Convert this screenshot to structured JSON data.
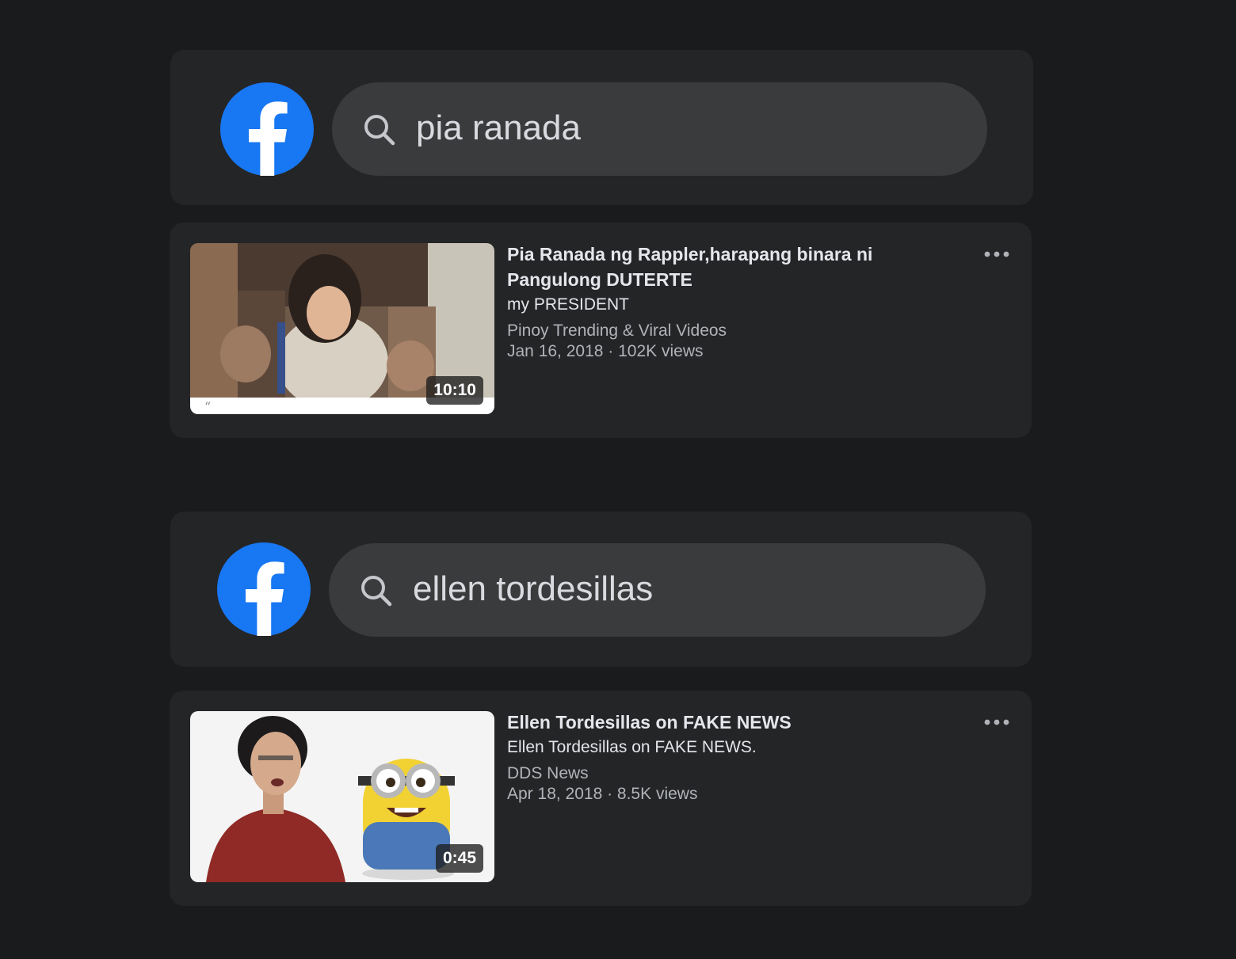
{
  "colors": {
    "background": "#1a1b1d",
    "panel": "#242527",
    "search_pill": "#3a3b3c",
    "facebook_blue": "#1877f2",
    "primary_text": "#e4e6eb",
    "secondary_text": "#b0b3b8"
  },
  "searches": [
    {
      "logo_icon": "facebook-logo-icon",
      "search_icon": "search-icon",
      "query": "pia ranada",
      "result": {
        "title": "Pia Ranada ng Rappler,harapang binara ni Pangulong DUTERTE",
        "description": "my PRESIDENT",
        "channel": "Pinoy Trending & Viral Videos",
        "date": "Jan 16, 2018",
        "views": "102K views",
        "stats": "Jan 16, 2018 · 102K views",
        "duration": "10:10",
        "more_icon": "more-options-icon"
      }
    },
    {
      "logo_icon": "facebook-logo-icon",
      "search_icon": "search-icon",
      "query": "ellen tordesillas",
      "result": {
        "title": "Ellen Tordesillas on FAKE NEWS",
        "description": "Ellen Tordesillas on FAKE NEWS.",
        "channel": "DDS News",
        "date": "Apr 18, 2018",
        "views": "8.5K views",
        "stats": "Apr 18, 2018 · 8.5K views",
        "duration": "0:45",
        "more_icon": "more-options-icon"
      }
    }
  ]
}
